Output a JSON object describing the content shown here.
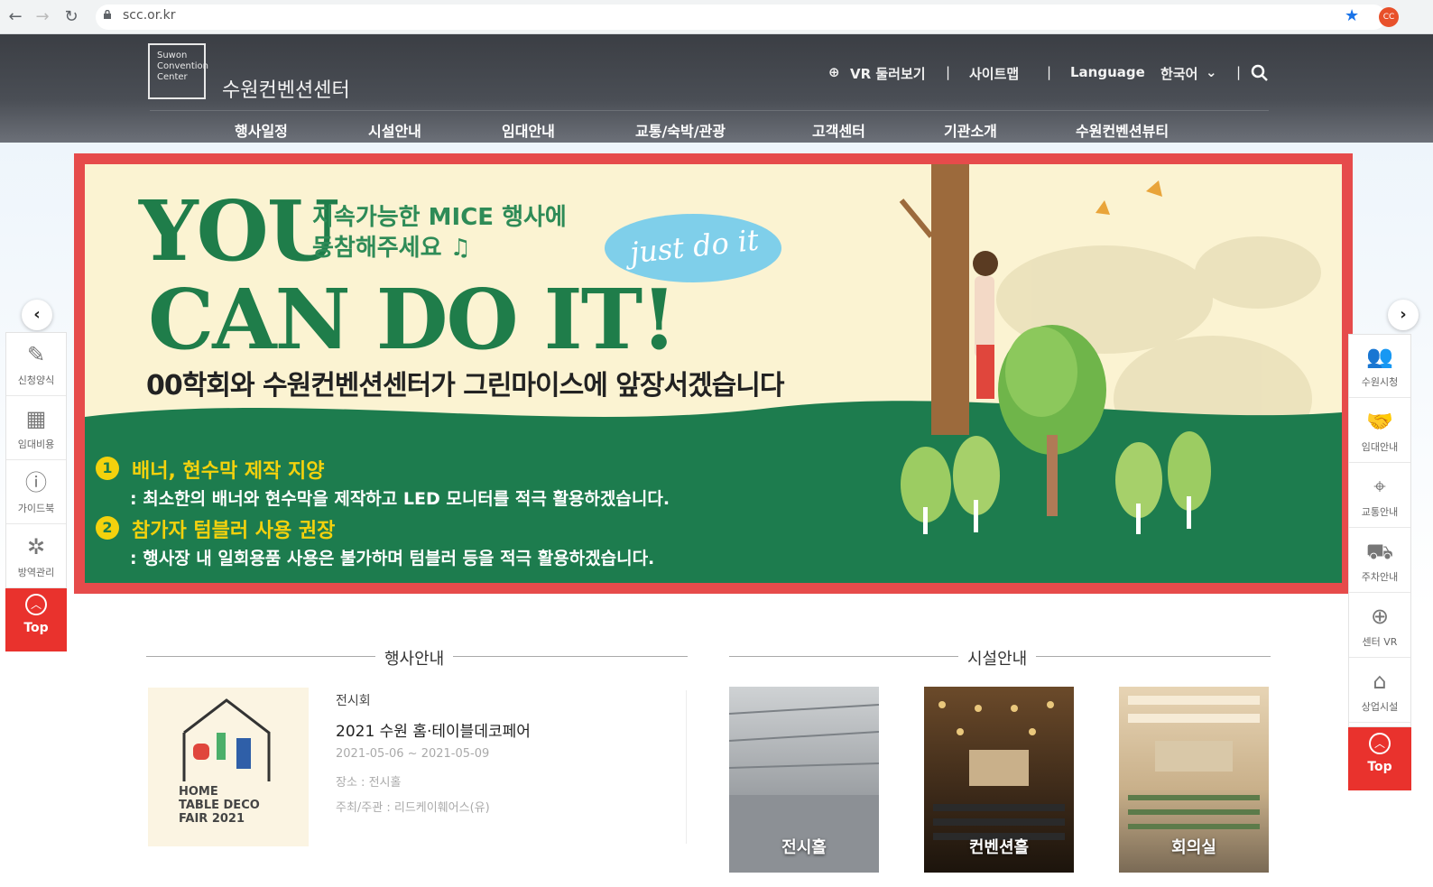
{
  "browser": {
    "url": "scc.or.kr",
    "profile_initials": "CC"
  },
  "header": {
    "logo_lines": [
      "Suwon",
      "Convention",
      "Center"
    ],
    "site_name": "수원컨벤션센터",
    "util": {
      "vr": "VR 둘러보기",
      "sep": "|",
      "sitemap": "사이트맵",
      "language": "Language",
      "lang_value": "한국어"
    },
    "nav": [
      "행사일정",
      "시설안내",
      "임대안내",
      "교통/숙박/관광",
      "고객센터",
      "기관소개",
      "수원컨벤션뷰티"
    ]
  },
  "banner": {
    "headline_1": "YOU",
    "headline_2": "CAN DO IT!",
    "sub_1": "지속가능한 MICE 행사에",
    "sub_2": "동참해주세요 ♫",
    "bubble": "just do it",
    "main": "00학회와 수원컨벤션센터가 그린마이스에 앞장서겠습니다",
    "points": [
      {
        "num": "1",
        "title": "배너, 현수막 제작 지양",
        "desc": ": 최소한의 배너와 현수막을 제작하고 LED 모니터를 적극 활용하겠습니다."
      },
      {
        "num": "2",
        "title": "참가자 텀블러 사용 권장",
        "desc": ": 행사장 내 일회용품 사용은 불가하며 텀블러 등을 적극 활용하겠습니다."
      }
    ],
    "colors": {
      "frame": "#e64b4b",
      "green": "#1f7d4a",
      "cream": "#fbf3d2",
      "yellow": "#f4d20d"
    }
  },
  "left_menu": {
    "arrow": "‹",
    "items": [
      {
        "icon": "form-icon",
        "glyph": "✎",
        "label": "신청양식"
      },
      {
        "icon": "fee-icon",
        "glyph": "▦",
        "label": "임대비용"
      },
      {
        "icon": "guide-icon",
        "glyph": "ⓘ",
        "label": "가이드북"
      },
      {
        "icon": "quarantine-icon",
        "glyph": "✲",
        "label": "방역관리"
      }
    ],
    "top_label": "Top"
  },
  "right_menu": {
    "arrow": "›",
    "items": [
      {
        "icon": "people-icon",
        "glyph": "👥",
        "label": "수원시청"
      },
      {
        "icon": "handshake-icon",
        "glyph": "🤝",
        "label": "임대안내"
      },
      {
        "icon": "map-pin-icon",
        "glyph": "⌖",
        "label": "교통안내"
      },
      {
        "icon": "car-icon",
        "glyph": "⛟",
        "label": "주차안내"
      },
      {
        "icon": "globe-icon",
        "glyph": "⊕",
        "label": "센터 VR"
      },
      {
        "icon": "store-icon",
        "glyph": "⌂",
        "label": "상업시설"
      }
    ],
    "top_label": "Top"
  },
  "events": {
    "section_title": "행사안내",
    "thumb_text": [
      "HOME",
      "TABLE DECO",
      "FAIR 2021"
    ],
    "category": "전시회",
    "title": "2021 수원 홈·테이블데코페어",
    "date": "2021-05-06 ~ 2021-05-09",
    "place": "장소 : 전시홀",
    "host": "주최/주관 : 리드케이훼어스(유)"
  },
  "facilities": {
    "section_title": "시설안내",
    "items": [
      {
        "label": "전시홀"
      },
      {
        "label": "컨벤션홀"
      },
      {
        "label": "회의실"
      }
    ]
  }
}
